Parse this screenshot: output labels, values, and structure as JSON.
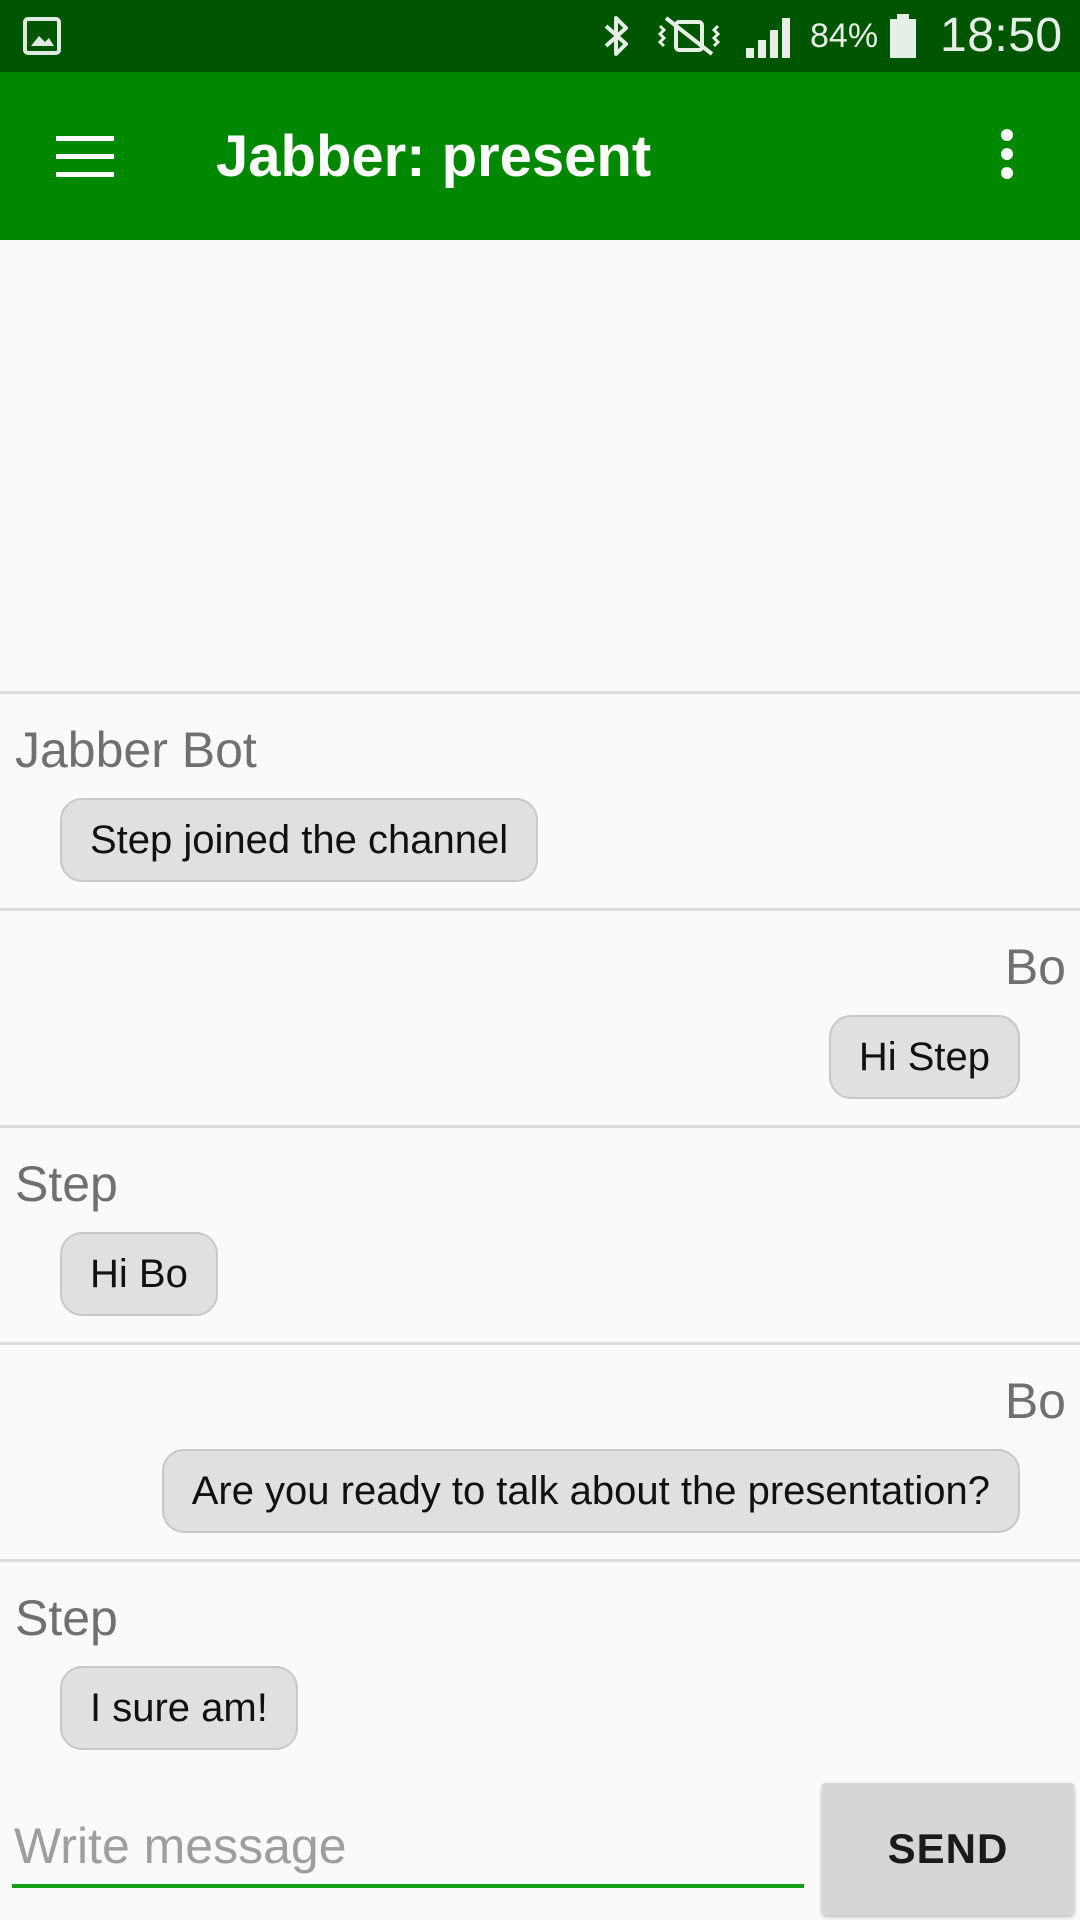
{
  "status_bar": {
    "left_icon": "gallery-icon",
    "icons": [
      "bluetooth-icon",
      "vibrate-mute-icon",
      "signal-icon",
      "battery-icon"
    ],
    "battery_percent": "84%",
    "time": "18:50"
  },
  "app_bar": {
    "title": "Jabber: present",
    "menu_icon": "hamburger-menu-icon",
    "overflow_icon": "more-vert-icon",
    "color": "#008800"
  },
  "messages": [
    {
      "sender": "Jabber Bot",
      "text": "Step joined the channel",
      "side": "left"
    },
    {
      "sender": "Bo",
      "text": "Hi Step",
      "side": "right"
    },
    {
      "sender": "Step",
      "text": "Hi Bo",
      "side": "left"
    },
    {
      "sender": "Bo",
      "text": "Are you ready to talk about the presentation?",
      "side": "right"
    },
    {
      "sender": "Step",
      "text": "I sure am!",
      "side": "left"
    }
  ],
  "composer": {
    "placeholder": "Write message",
    "value": "",
    "send_label": "SEND",
    "accent": "#13a013"
  }
}
